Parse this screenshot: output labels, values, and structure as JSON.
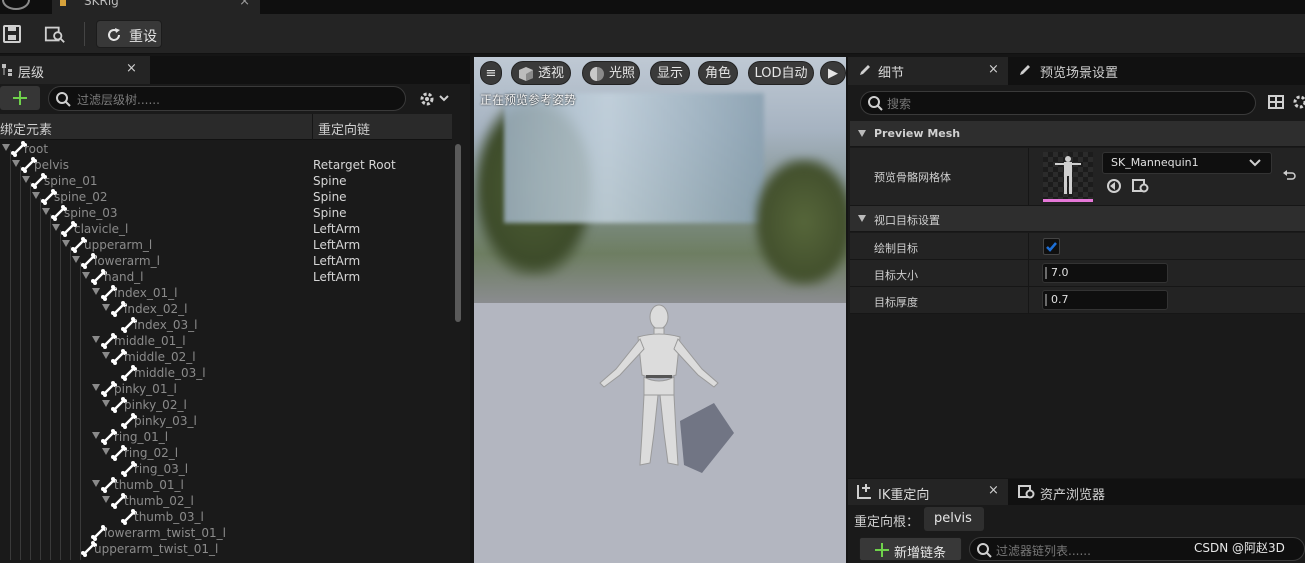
{
  "asset_tab": {
    "label": "SKRig"
  },
  "toolbar": {
    "reset_label": "重设"
  },
  "hierarchy": {
    "tab_label": "层级",
    "tab_close": "×",
    "search_placeholder": "过滤层级树......",
    "col_bone": "绑定元素",
    "col_chain": "重定向链",
    "rows": [
      {
        "name": "root",
        "chain": ""
      },
      {
        "name": "pelvis",
        "chain": "Retarget Root"
      },
      {
        "name": "spine_01",
        "chain": "Spine"
      },
      {
        "name": "spine_02",
        "chain": "Spine"
      },
      {
        "name": "spine_03",
        "chain": "Spine"
      },
      {
        "name": "clavicle_l",
        "chain": "LeftArm"
      },
      {
        "name": "upperarm_l",
        "chain": "LeftArm"
      },
      {
        "name": "lowerarm_l",
        "chain": "LeftArm"
      },
      {
        "name": "hand_l",
        "chain": "LeftArm"
      },
      {
        "name": "index_01_l",
        "chain": ""
      },
      {
        "name": "index_02_l",
        "chain": ""
      },
      {
        "name": "index_03_l",
        "chain": ""
      },
      {
        "name": "middle_01_l",
        "chain": ""
      },
      {
        "name": "middle_02_l",
        "chain": ""
      },
      {
        "name": "middle_03_l",
        "chain": ""
      },
      {
        "name": "pinky_01_l",
        "chain": ""
      },
      {
        "name": "pinky_02_l",
        "chain": ""
      },
      {
        "name": "pinky_03_l",
        "chain": ""
      },
      {
        "name": "ring_01_l",
        "chain": ""
      },
      {
        "name": "ring_02_l",
        "chain": ""
      },
      {
        "name": "ring_03_l",
        "chain": ""
      },
      {
        "name": "thumb_01_l",
        "chain": ""
      },
      {
        "name": "thumb_02_l",
        "chain": ""
      },
      {
        "name": "thumb_03_l",
        "chain": ""
      },
      {
        "name": "lowerarm_twist_01_l",
        "chain": ""
      },
      {
        "name": "upperarm_twist_01_l",
        "chain": ""
      }
    ]
  },
  "viewport": {
    "status_text": "正在预览参考姿势",
    "buttons": {
      "menu": "≡",
      "perspective": "透视",
      "lighting": "光照",
      "show": "显示",
      "character": "角色",
      "lod": "LOD自动",
      "play": "▶"
    }
  },
  "details": {
    "tab_label": "细节",
    "tab_close": "×",
    "scene_tab_label": "预览场景设置",
    "search_placeholder": "搜索",
    "section_preview_mesh": "Preview Mesh",
    "preview_mesh_label": "预览骨骼网格体",
    "preview_mesh_value": "SK_Mannequin1",
    "section_viewport_goal": "视口目标设置",
    "draw_goals_label": "绘制目标",
    "draw_goals_checked": true,
    "goal_size_label": "目标大小",
    "goal_size_value": "7.0",
    "goal_thickness_label": "目标厚度",
    "goal_thickness_value": "0.7"
  },
  "ik_retarget": {
    "tab_label": "IK重定向",
    "tab_close": "×",
    "asset_browser_label": "资产浏览器",
    "root_label": "重定向根：",
    "root_value": "pelvis",
    "add_chain_label": "新增链条",
    "chain_search_placeholder": "过滤器链列表......"
  },
  "watermark": "CSDN @阿赵3D",
  "colors": {
    "accent_blue": "#1d6fd6",
    "mesh_pink": "#e678d8",
    "add_green": "#6fd24b"
  }
}
